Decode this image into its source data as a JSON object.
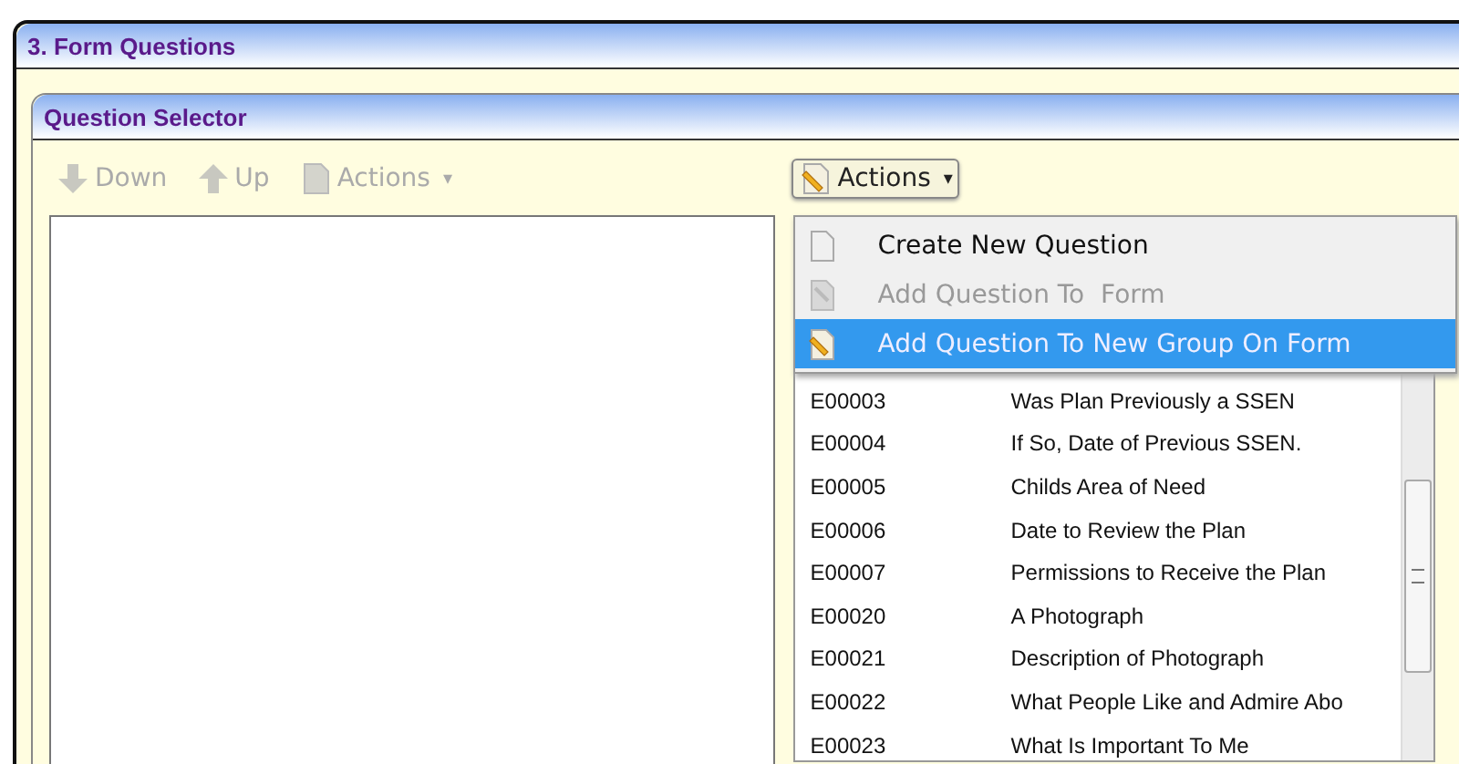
{
  "panel": {
    "title": "3. Form Questions"
  },
  "selector": {
    "title": "Question Selector"
  },
  "left_toolbar": [
    {
      "label": "Down",
      "kind": "down",
      "disabled": true
    },
    {
      "label": "Up",
      "kind": "up",
      "disabled": true
    },
    {
      "label": "Actions",
      "kind": "actions",
      "disabled": true,
      "caret": "▾"
    }
  ],
  "actions_button": {
    "label": "Actions",
    "caret": "▾"
  },
  "actions_menu": [
    {
      "label": "Create New Question",
      "kind": "blank",
      "disabled": false,
      "selected": false
    },
    {
      "label": "Add Question To  Form",
      "kind": "note",
      "disabled": true,
      "selected": false
    },
    {
      "label": "Add Question To New Group On Form",
      "kind": "pencil",
      "disabled": false,
      "selected": true
    }
  ],
  "questions": [
    {
      "code": "E00003",
      "title": "Was Plan Previously a SSEN"
    },
    {
      "code": "E00004",
      "title": "If So, Date of Previous SSEN."
    },
    {
      "code": "E00005",
      "title": "Childs Area of Need"
    },
    {
      "code": "E00006",
      "title": "Date to Review the Plan"
    },
    {
      "code": "E00007",
      "title": "Permissions to Receive the Plan"
    },
    {
      "code": "E00020",
      "title": "A Photograph"
    },
    {
      "code": "E00021",
      "title": "Description of Photograph"
    },
    {
      "code": "E00022",
      "title": "What People Like and Admire Abo"
    },
    {
      "code": "E00023",
      "title": "What Is Important To Me"
    }
  ]
}
